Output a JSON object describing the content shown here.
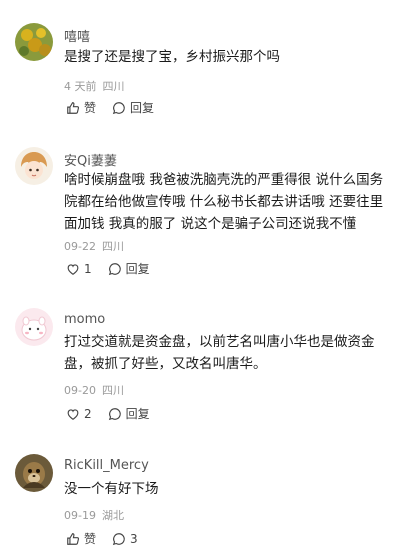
{
  "comments": [
    {
      "username": "嘻嘻",
      "text": "是搜了还是搜了宝，乡村振兴那个吗",
      "time": "4 天前",
      "location": "四川",
      "like_label": "赞",
      "reply_label": "回复"
    },
    {
      "username": "安Qi萋萋",
      "text": "啥时候崩盘哦 我爸被洗脑壳洗的严重得很 说什么国务院都在给他做宣传哦 什么秘书长都去讲话哦 还要往里面加钱 我真的服了 说这个是骗子公司还说我不懂",
      "time": "09-22",
      "location": "四川",
      "like_count": "1",
      "reply_label": "回复"
    },
    {
      "username": "momo",
      "text": "打过交道就是资金盘，以前艺名叫唐小华也是做资金盘，被抓了好些，又改名叫唐华。",
      "time": "09-20",
      "location": "四川",
      "like_count": "2",
      "reply_label": "回复"
    },
    {
      "username": "RicKill_Mercy",
      "text": "没一个有好下场",
      "time": "09-19",
      "location": "湖北",
      "like_label": "赞",
      "reply_count": "3"
    }
  ]
}
